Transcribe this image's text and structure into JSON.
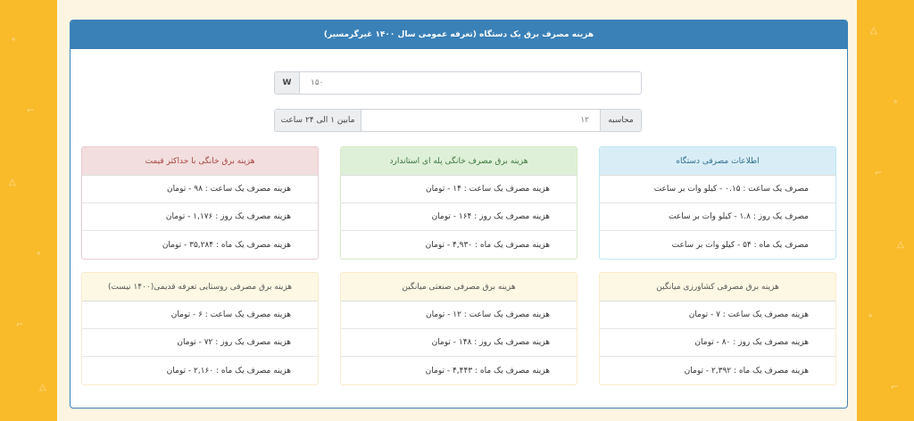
{
  "header": {
    "title": "هزینه مصرف برق یک دستگاه (تعرفه عمومی سال ۱۴۰۰ غیرگرمسیر)"
  },
  "power_input": {
    "unit": "W",
    "value": "۱۵۰"
  },
  "hours_input": {
    "button": "محاسبه",
    "value": "۱۲",
    "hint": "مابین ۱ الی ۲۴ ساعت"
  },
  "colors": {
    "header_blue": "#3a81b8",
    "background": "#f9bb2a",
    "panel_bg": "#fdf5e2"
  },
  "cards": {
    "info": {
      "title": "اطلاعات مصرفی دستگاه",
      "rows": [
        "مصرف یک ساعت : ۰.۱۵ - کیلو وات بر ساعت",
        "مصرف یک روز : ۱.۸ - کیلو وات بر ساعت",
        "مصرف یک ماه : ۵۴ - کیلو وات بر ساعت"
      ]
    },
    "standard": {
      "title": "هزینه برق مصرف خانگی پله ای استاندارد",
      "rows": [
        "هزینه مصرف یک ساعت : ۱۴ - تومان",
        "هزینه مصرف یک روز : ۱۶۴ - تومان",
        "هزینه مصرف یک ماه : ۴,۹۳۰ - تومان"
      ]
    },
    "max_price": {
      "title": "هزینه برق خانگی با حداکثر قیمت",
      "rows": [
        "هزینه مصرف یک ساعت : ۹۸ - تومان",
        "هزینه مصرف یک روز : ۱,۱۷۶ - تومان",
        "هزینه مصرف یک ماه : ۳۵,۲۸۴ - تومان"
      ]
    },
    "agriculture": {
      "title": "هزینه برق مصرفی کشاورزی میانگین",
      "rows": [
        "هزینه مصرف یک ساعت : ۷ - تومان",
        "هزینه مصرف یک روز : ۸۰ - تومان",
        "هزینه مصرف یک ماه : ۲,۳۹۲ - تومان"
      ]
    },
    "industrial": {
      "title": "هزینه برق مصرفی صنعتی میانگین",
      "rows": [
        "هزینه مصرف یک ساعت : ۱۲ - تومان",
        "هزینه مصرف یک روز : ۱۴۸ - تومان",
        "هزینه مصرف یک ماه : ۴,۴۴۳ - تومان"
      ]
    },
    "rural": {
      "title": "هزینه برق مصرفی روستایی تعرفه قدیمی(۱۴۰۰ نیست)",
      "rows": [
        "هزینه مصرف یک ساعت : ۶ - تومان",
        "هزینه مصرف یک روز : ۷۲ - تومان",
        "هزینه مصرف یک ماه : ۲,۱۶۰ - تومان"
      ]
    }
  }
}
